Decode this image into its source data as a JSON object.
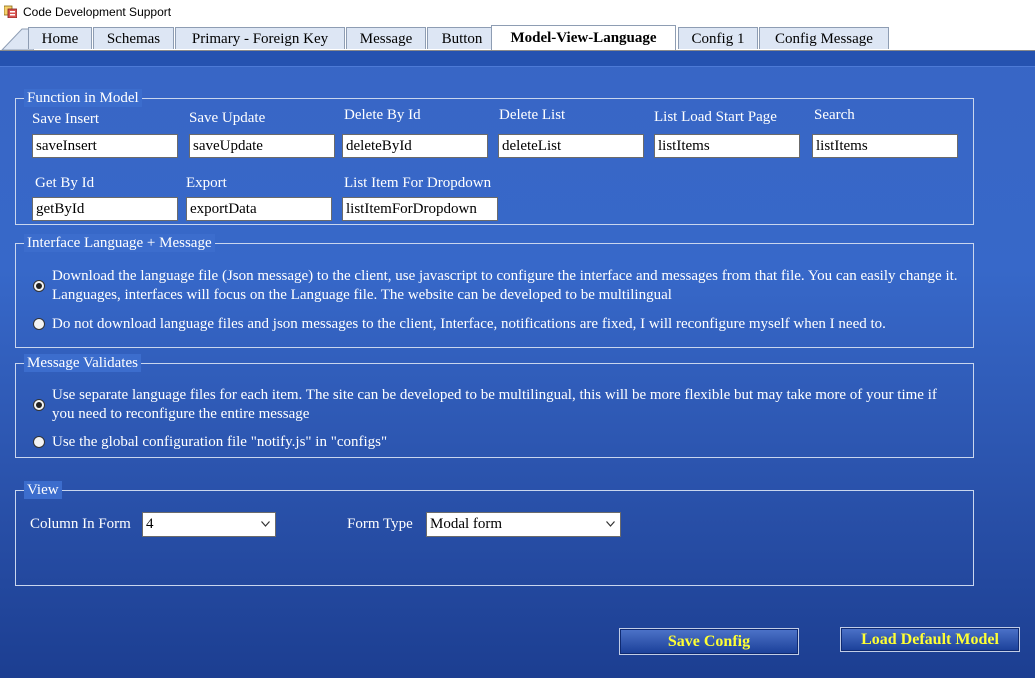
{
  "window": {
    "title": "Code Development Support",
    "app_icon": "form-app-icon"
  },
  "tabs": [
    {
      "label": "Home"
    },
    {
      "label": "Schemas"
    },
    {
      "label": "Primary - Foreign Key"
    },
    {
      "label": "Message"
    },
    {
      "label": "Button"
    },
    {
      "label": "Model-View-Language",
      "active": true
    },
    {
      "label": "Config 1"
    },
    {
      "label": "Config Message"
    }
  ],
  "function_in_model": {
    "legend": "Function in Model",
    "fields": [
      {
        "label": "Save Insert",
        "value": "saveInsert"
      },
      {
        "label": "Save Update",
        "value": "saveUpdate"
      },
      {
        "label": "Delete By Id",
        "value": "deleteById"
      },
      {
        "label": "Delete List",
        "value": "deleteList"
      },
      {
        "label": "List Load Start Page",
        "value": "listItems"
      },
      {
        "label": "Search",
        "value": "listItems"
      },
      {
        "label": "Get By Id",
        "value": "getById"
      },
      {
        "label": "Export",
        "value": "exportData"
      },
      {
        "label": "List Item For Dropdown",
        "value": "listItemForDropdown"
      }
    ]
  },
  "interface_language": {
    "legend": "Interface Language + Message",
    "options": [
      {
        "text": "Download the language file (Json message) to the client, use javascript to configure the interface and messages from that file. You can easily change it. Languages, interfaces will focus on the Language file. The website can be developed to be multilingual",
        "checked": true
      },
      {
        "text": "Do not download language files and json messages to the client, Interface, notifications are fixed, I will reconfigure myself when I need to.",
        "checked": false
      }
    ]
  },
  "message_validates": {
    "legend": "Message Validates",
    "options": [
      {
        "text": "Use separate language files for each item. The site can be developed to be multilingual, this will be more flexible but may take more of your time if you need to reconfigure the entire message",
        "checked": true
      },
      {
        "text": "Use the global configuration file \"notify.js\" in \"configs\"",
        "checked": false
      }
    ]
  },
  "view": {
    "legend": "View",
    "column_in_form": {
      "label": "Column In Form",
      "value": "4"
    },
    "form_type": {
      "label": "Form Type",
      "value": "Modal form"
    }
  },
  "buttons": {
    "save_config": "Save  Config",
    "load_default": "Load Default Model"
  },
  "colors": {
    "accent_button_text": "#ffff33",
    "panel_blue": "#3768c9"
  }
}
